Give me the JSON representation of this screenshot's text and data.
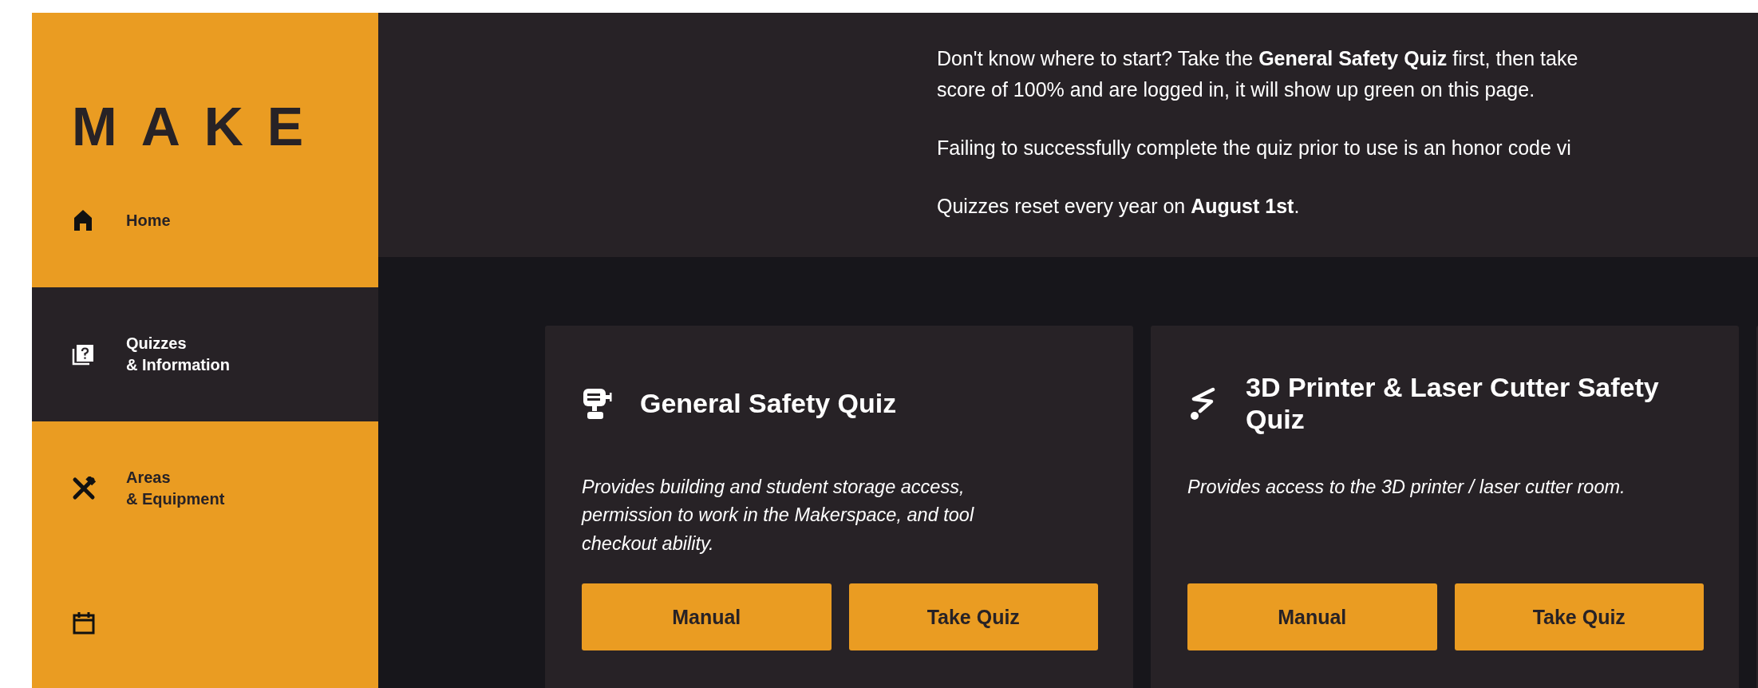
{
  "logo": "MAKE",
  "nav": [
    {
      "kind": "home",
      "label": "Home",
      "selected": false
    },
    {
      "kind": "quizzes",
      "label": "Quizzes\n& Information",
      "selected": true
    },
    {
      "kind": "tools",
      "label": "Areas\n& Equipment",
      "selected": false
    },
    {
      "kind": "calendar",
      "selected": false
    }
  ],
  "intro": [
    "Don't know where to start? Take the **General Safety Quiz** first, then take\nscore of 100% and are logged in, it will show up green on this page.",
    "Failing to successfully complete the quiz prior to use is an honor code vi",
    "Quizzes reset every year on **August 1st**."
  ],
  "cards": [
    {
      "kind": "drill",
      "title": "General Safety Quiz",
      "description": "Provides building and student storage access, permission to work in the Makerspace, and tool checkout ability.",
      "buttons": [
        "Manual",
        "Take Quiz"
      ]
    },
    {
      "kind": "laser",
      "title": "3D Printer & Laser Cutter Safety Quiz",
      "description": "Provides access to the 3D printer / laser cutter room.",
      "buttons": [
        "Manual",
        "Take Quiz"
      ]
    },
    {
      "kind": "stub"
    }
  ]
}
